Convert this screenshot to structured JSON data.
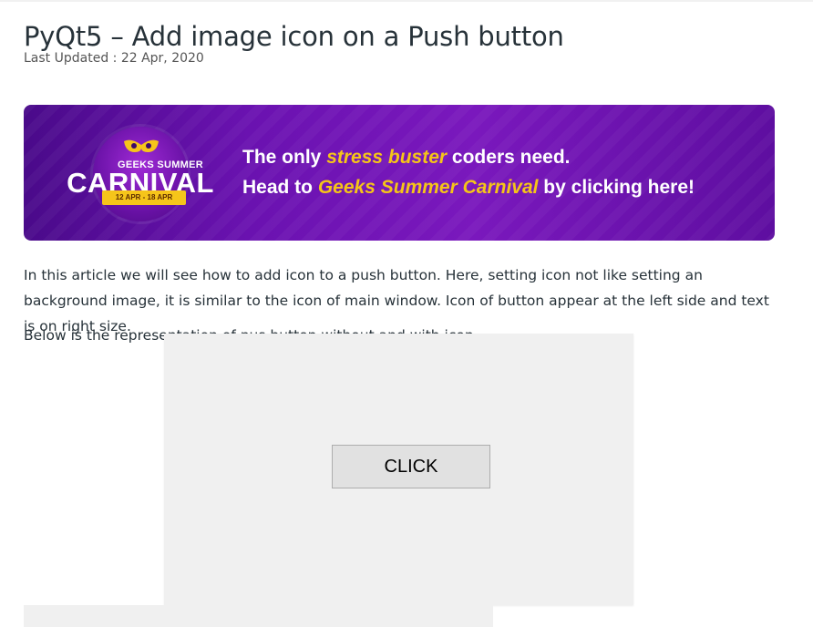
{
  "article": {
    "title": "PyQt5 – Add image icon on a Push button",
    "last_updated": "Last Updated : 22 Apr, 2020"
  },
  "banner": {
    "badge_top": "GEEKS SUMMER",
    "badge_main": "CARNIVAL",
    "badge_dates": "12 APR - 18 APR",
    "line1_pre": "The only ",
    "line1_highlight": "stress buster",
    "line1_post": " coders need.",
    "line2_pre": "Head to ",
    "line2_highlight": "Geeks Summer Carnival",
    "line2_post": " by clicking here!",
    "colors": {
      "highlight": "#f5c518",
      "background": "#6a12b0"
    }
  },
  "body": {
    "para1": "In this article we will see how to add icon to a push button. Here, setting icon not like setting an background image, it is similar to the icon of main window. Icon of button appear at the left side and text is on right size.",
    "para2": "Below is the representation of pus button without and with icon."
  },
  "demo_window": {
    "button_label": "CLICK"
  }
}
